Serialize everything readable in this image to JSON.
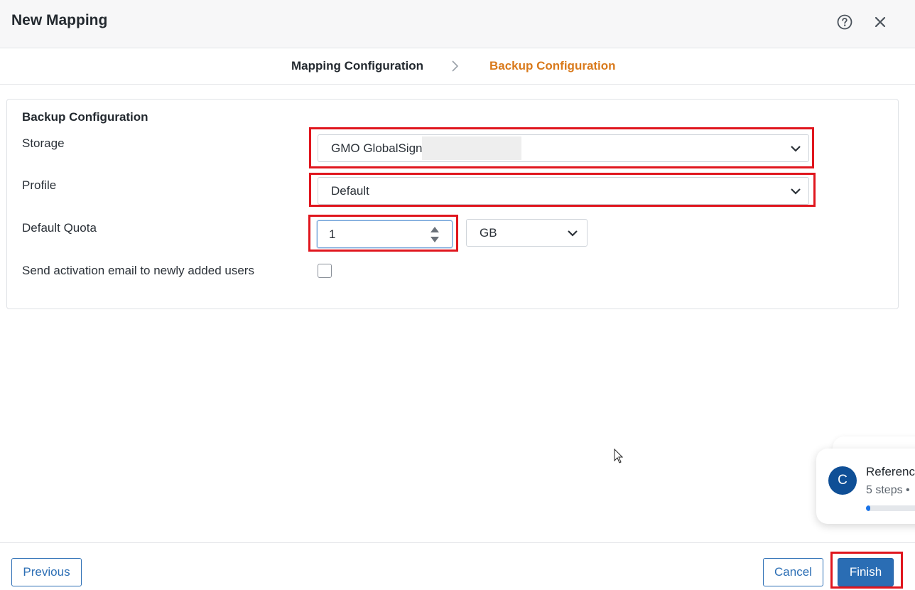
{
  "dialog": {
    "title": "New Mapping"
  },
  "wizard": {
    "steps": [
      {
        "label": "Mapping Configuration",
        "state": "completed"
      },
      {
        "label": "Backup Configuration",
        "state": "active"
      }
    ]
  },
  "form": {
    "section_title": "Backup Configuration",
    "storage": {
      "label": "Storage",
      "value": "GMO GlobalSign"
    },
    "profile": {
      "label": "Profile",
      "value": "Default"
    },
    "quota": {
      "label": "Default Quota",
      "value": "1",
      "unit": "GB"
    },
    "activation": {
      "label": "Send activation email to newly added users",
      "checked": false
    }
  },
  "footer": {
    "previous_label": "Previous",
    "cancel_label": "Cancel",
    "finish_label": "Finish"
  },
  "toast": {
    "avatar_letter": "C",
    "title": "Reference",
    "subtitle": "5 steps •",
    "progress": 0.05
  },
  "colors": {
    "active_step": "#d97a1c",
    "primary": "#2a6db4",
    "highlight": "#e0161e"
  }
}
